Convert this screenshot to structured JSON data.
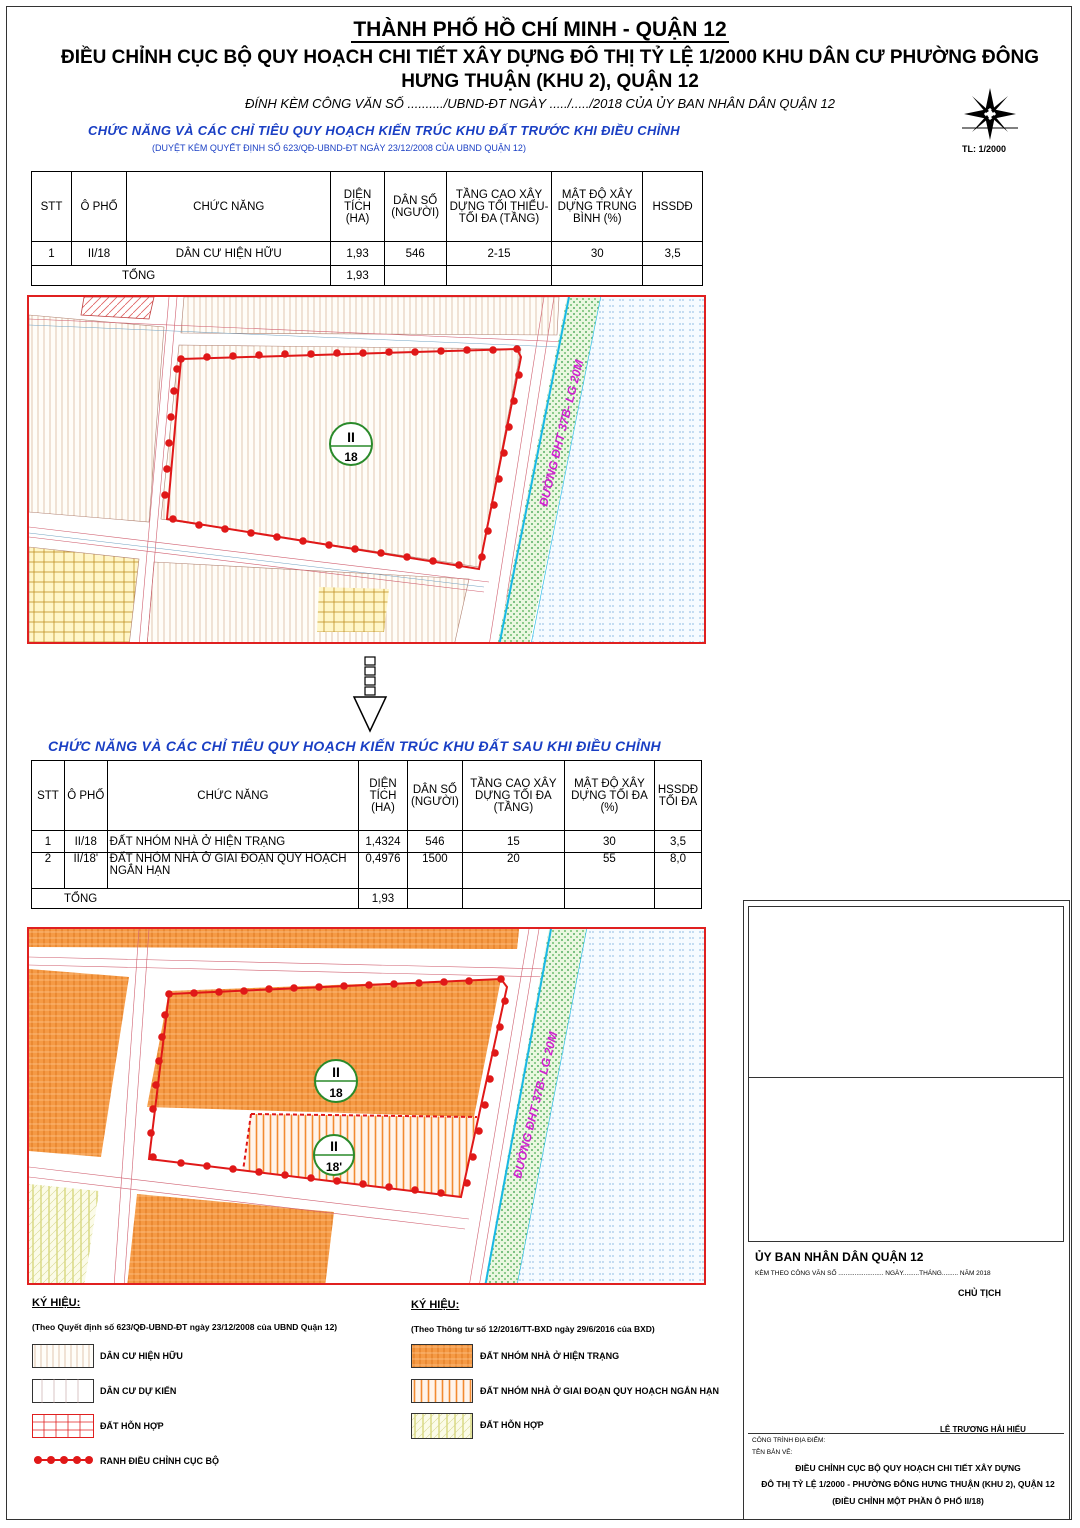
{
  "header": {
    "title": "THÀNH PHỐ HỒ CHÍ MINH - QUẬN 12",
    "subtitle_line1": "ĐIỀU CHỈNH CỤC BỘ QUY HOẠCH CHI TIẾT XÂY DỰNG ĐÔ THỊ TỶ LỆ 1/2000 KHU DÂN CƯ PHƯỜNG ĐÔNG",
    "subtitle_line2": "HƯNG THUẬN (KHU 2), QUẬN 12",
    "note": "ĐÍNH KÈM CÔNG VĂN SỐ ........../UBND-ĐT NGÀY ...../...../2018 CỦA ỦY BAN NHÂN DÂN QUẬN 12",
    "scale": "TL: 1/2000"
  },
  "before": {
    "title": "CHỨC NĂNG VÀ CÁC CHỈ TIÊU QUY HOẠCH KIẾN TRÚC KHU ĐẤT TRƯỚC KHI ĐIỀU CHỈNH",
    "subtitle": "(DUYỆT KÈM QUYẾT ĐỊNH SỐ 623/QĐ-UBND-ĐT NGÀY 23/12/2008 CỦA UBND QUẬN 12)",
    "headers": [
      "STT",
      "Ô PHỐ",
      "CHỨC NĂNG",
      "DIỆN TÍCH (HA)",
      "DÂN SỐ (NGƯỜI)",
      "TẦNG CAO XÂY DỰNG TỐI THIỂU- TỐI ĐA (TẦNG)",
      "MẬT ĐỘ XÂY DỰNG TRUNG BÌNH (%)",
      "HSSDĐ"
    ],
    "rows": [
      [
        "1",
        "II/18",
        "DÂN CƯ HIỆN HỮU",
        "1,93",
        "546",
        "2-15",
        "30",
        "3,5"
      ]
    ],
    "total_label": "TỔNG",
    "total_area": "1,93"
  },
  "after": {
    "title": "CHỨC NĂNG VÀ CÁC CHỈ TIÊU QUY HOẠCH KIẾN TRÚC KHU ĐẤT SAU KHI ĐIỀU CHỈNH",
    "headers": [
      "STT",
      "Ô PHỐ",
      "CHỨC NĂNG",
      "DIỆN TÍCH (HA)",
      "DÂN SỐ (NGƯỜI)",
      "TẦNG CAO XÂY DỰNG TỐI ĐA (TẦNG)",
      "MẬT ĐỘ XÂY DỰNG TỐI ĐA (%)",
      "HSSDĐ TỐI ĐA"
    ],
    "rows": [
      [
        "1",
        "II/18",
        "ĐẤT NHÓM NHÀ Ở HIỆN TRẠNG",
        "1,4324",
        "546",
        "15",
        "30",
        "3,5"
      ],
      [
        "2",
        "II/18'",
        "ĐẤT NHÓM NHÀ Ở GIAI ĐOẠN QUY HOẠCH NGẮN HẠN",
        "0,4976",
        "1500",
        "20",
        "55",
        "8,0"
      ]
    ],
    "total_label": "TỔNG",
    "total_area": "1,93"
  },
  "map_top": {
    "road_label": "ĐƯỜNG ĐHT 37B- LG 20M",
    "block_top": "II",
    "block_bottom": "18"
  },
  "map_bottom": {
    "road_label": "ĐƯỜNG ĐHT 37B- LG 20M",
    "block1_top": "II",
    "block1_bottom": "18",
    "block2_top": "II",
    "block2_bottom": "18'"
  },
  "legend_left": {
    "title": "KÝ HIỆU:",
    "note": "(Theo Quyết định số 623/QĐ-UBND-ĐT ngày 23/12/2008 của UBND Quận 12)",
    "items": [
      "DÂN CƯ HIỆN HỮU",
      "DÂN CƯ DỰ KIẾN",
      "ĐẤT HỖN HỢP",
      "RANH ĐIỀU CHỈNH CỤC BỘ"
    ]
  },
  "legend_right": {
    "title": "KÝ HIỆU:",
    "note": "(Theo Thông tư số 12/2016/TT-BXD ngày 29/6/2016 của BXD)",
    "items": [
      "ĐẤT NHÓM NHÀ Ở HIỆN TRẠNG",
      "ĐẤT NHÓM NHÀ Ở GIAI ĐOẠN QUY HOẠCH NGẮN HẠN",
      "ĐẤT HỖN HỢP"
    ]
  },
  "title_block": {
    "org": "ỦY BAN NHÂN DÂN QUẬN 12",
    "ref": "KÈM THEO CÔNG VĂN SỐ ......................... NGÀY.........THÁNG......... NĂM 2018",
    "role": "CHỦ TỊCH",
    "signer": "LÊ TRƯƠNG HẢI HIẾU",
    "project_label": "CÔNG TRÌNH ĐỊA ĐIỂM:",
    "drawing_label": "TÊN BẢN VẼ:",
    "drawing_line1": "ĐIỀU CHỈNH CỤC BỘ QUY HOẠCH CHI TIẾT XÂY DỰNG",
    "drawing_line2": "ĐÔ THỊ TỶ LỆ 1/2000 - PHƯỜNG ĐÔNG HƯNG THUẬN (KHU 2), QUẬN 12",
    "drawing_line3": "(ĐIỀU CHỈNH MỘT PHẦN Ô PHỐ II/18)"
  },
  "colors": {
    "boundary_red": "#e01818",
    "title_blue": "#1a3fc4",
    "road_magenta": "#d020d0",
    "residential_orange": "#f59a45",
    "water_cyan": "#19b8e6",
    "mixed_green": "#c8d450"
  }
}
